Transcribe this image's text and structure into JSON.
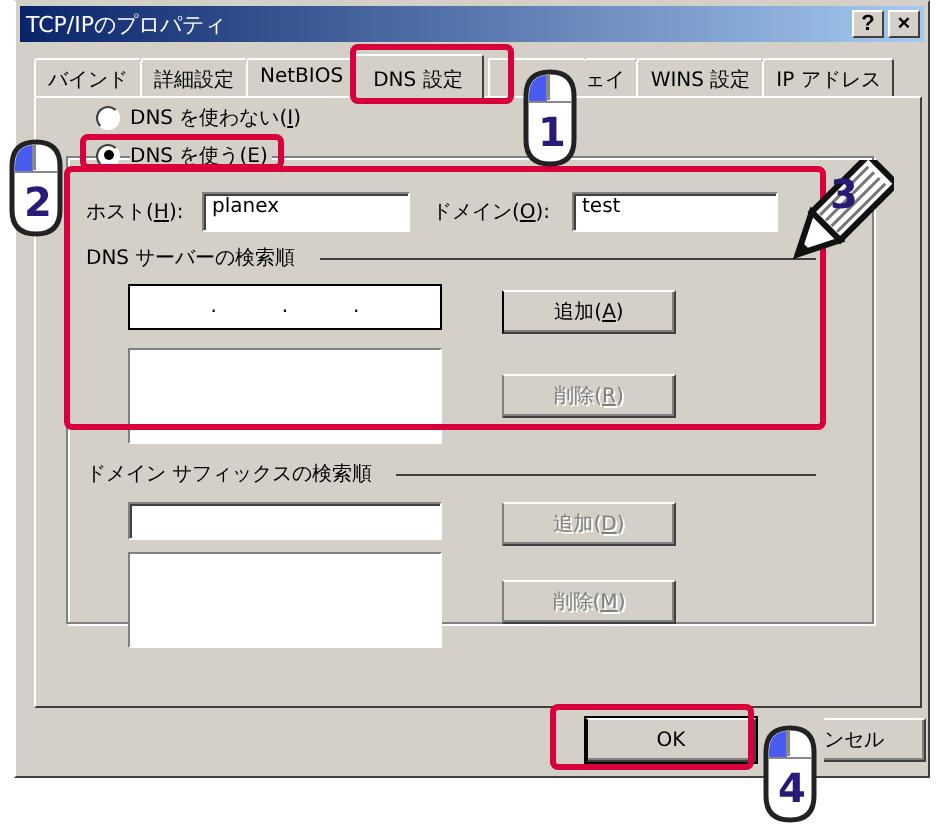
{
  "window": {
    "title": "TCP/IPのプロパティ",
    "help_button": "?",
    "close_button": "×"
  },
  "tabs": [
    {
      "label": "バインド",
      "selected": false
    },
    {
      "label": "詳細設定",
      "selected": false
    },
    {
      "label": "NetBIOS",
      "selected": false
    },
    {
      "label": "DNS 設定",
      "selected": true
    },
    {
      "label": "ェイ",
      "selected": false
    },
    {
      "label": "WINS 設定",
      "selected": false
    },
    {
      "label": "IP アドレス",
      "selected": false
    }
  ],
  "dns_mode": [
    {
      "label": "DNS を使わない(I)",
      "selected": false
    },
    {
      "label": "DNS を使う(E)",
      "selected": true
    }
  ],
  "host": {
    "label": "ホスト(H):",
    "value": "planex"
  },
  "domain": {
    "label": "ドメイン(O):",
    "value": "test"
  },
  "dns_server_order": {
    "heading": "DNS サーバーの検索順",
    "ip_separators": [
      ".",
      ".",
      "."
    ],
    "buttons": [
      {
        "label": "追加(A)",
        "disabled": false
      },
      {
        "label": "削除(R)",
        "disabled": true
      }
    ]
  },
  "domain_suffix_order": {
    "heading": "ドメイン サフィックスの検索順",
    "buttons": [
      {
        "label": "追加(D)",
        "disabled": true
      },
      {
        "label": "削除(M)",
        "disabled": true
      }
    ]
  },
  "footer_buttons": [
    {
      "label": "OK",
      "default": true
    },
    {
      "label": "ンセル",
      "default": false
    }
  ],
  "annotations": [
    {
      "kind": "frame"
    },
    {
      "kind": "frame"
    },
    {
      "kind": "frame"
    },
    {
      "kind": "frame"
    },
    {
      "kind": "mouse",
      "label": "1"
    },
    {
      "kind": "mouse",
      "label": "2"
    },
    {
      "kind": "pencil",
      "label": "3"
    },
    {
      "kind": "mouse",
      "label": "4"
    }
  ]
}
